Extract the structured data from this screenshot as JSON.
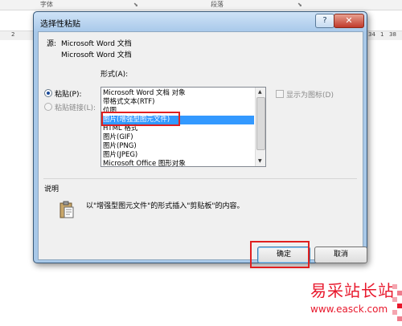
{
  "ribbon": {
    "font_group": "字体",
    "paragraph_group": "段落",
    "ruler_left": "2",
    "ruler_right": [
      "34",
      "1",
      "38"
    ]
  },
  "dialog": {
    "title": "选择性粘贴",
    "help": "?",
    "close": "✕",
    "source_label": "源:",
    "source_line1": "Microsoft Word 文档",
    "source_line2": "Microsoft Word 文档",
    "format_label": "形式(A):",
    "paste_label": "粘贴(P):",
    "paste_link_label": "粘贴链接(L):",
    "display_as_icon": "显示为图标(D)",
    "formats": [
      "Microsoft Word 文档 对象",
      "带格式文本(RTF)",
      "位图",
      "图片(增强型图元文件)",
      "HTML 格式",
      "图片(GIF)",
      "图片(PNG)",
      "图片(JPEG)",
      "Microsoft Office 图形对象"
    ],
    "selected_format_index": 3,
    "description_label": "说明",
    "description_text": "以\"增强型图元文件\"的形式插入\"剪贴板\"的内容。",
    "ok_button": "确定",
    "cancel_button": "取消"
  },
  "watermark": {
    "title": "易采站长站",
    "url": "www.easck.com"
  },
  "colors": {
    "selection": "#3399ff",
    "highlight_box": "#e02020",
    "watermark": "#e8182c"
  }
}
